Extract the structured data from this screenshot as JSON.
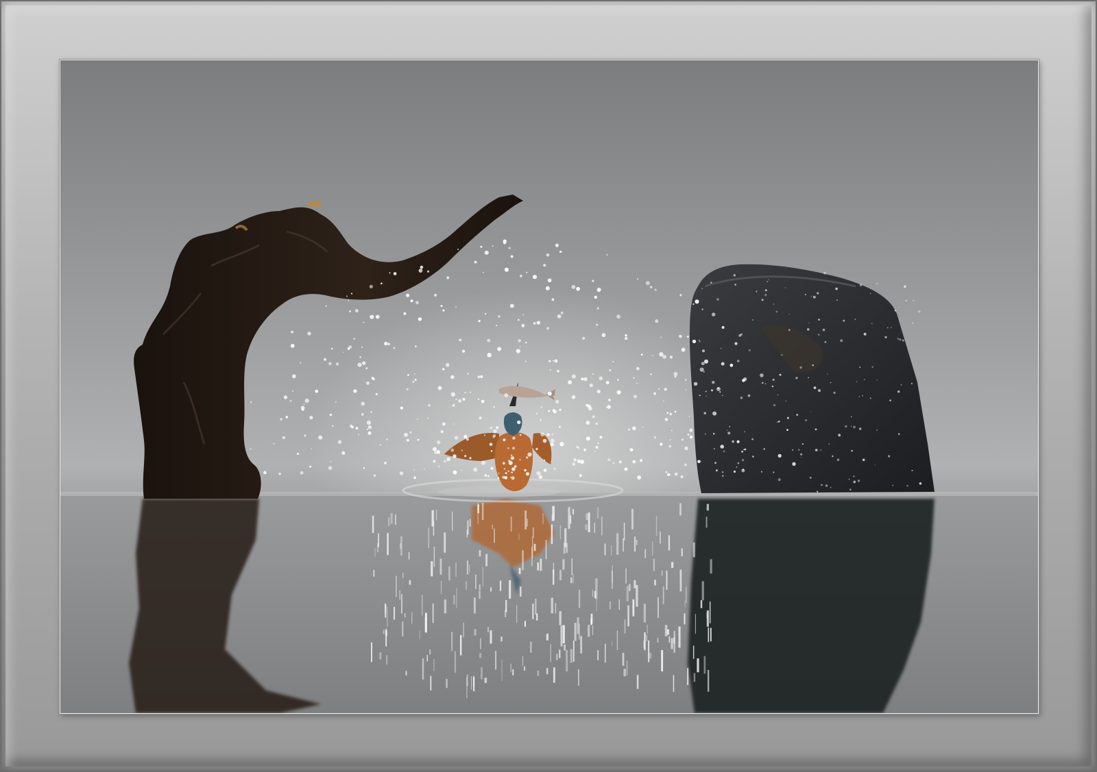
{
  "scene": {
    "subject": "kingfisher-with-fish",
    "colors": {
      "frame_light": "#d2d2d2",
      "frame_dark": "#8a8a8a",
      "sky_top": "#7d7e7f",
      "sky_mid": "#a3a4a5",
      "water": "#8f8f8f",
      "driftwood": "#241a14",
      "rock": "#2a2b2e",
      "bird_orange": "#b86a32",
      "bird_blue": "#3f5f6e",
      "sparkle": "#ffffff"
    }
  }
}
